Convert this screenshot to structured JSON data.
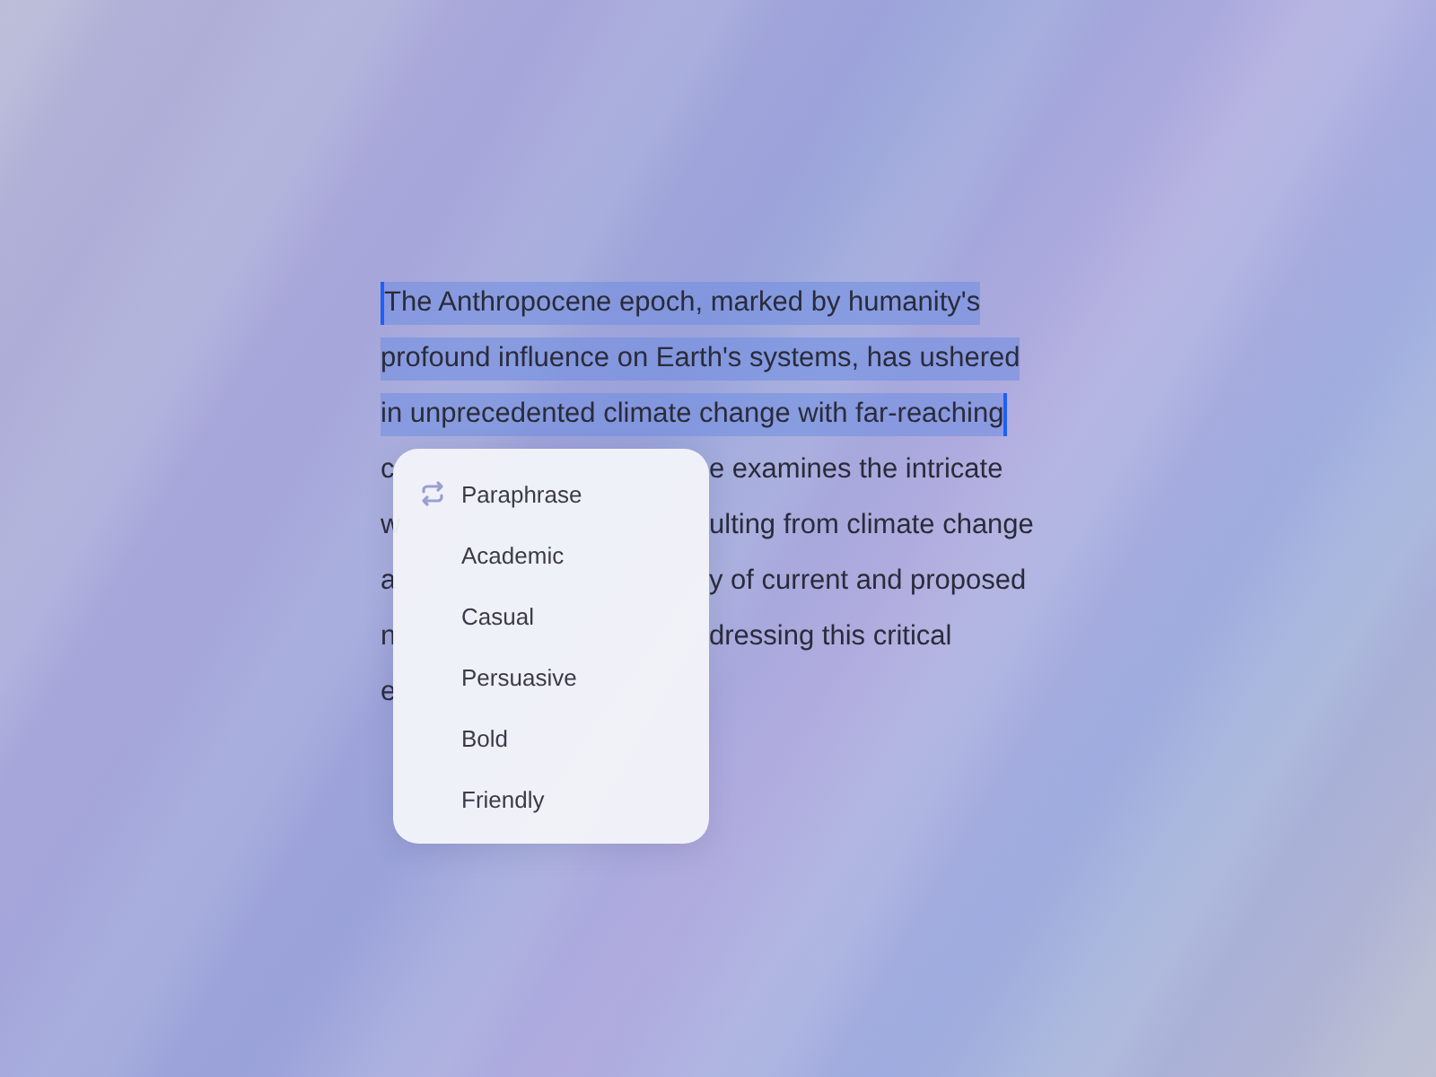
{
  "paragraph": {
    "lines": [
      {
        "start": "The Anthropocene epoch, marked by humanity's",
        "selected": true
      },
      {
        "start": "profound influence on Earth's systems, has ushered",
        "selected": true
      },
      {
        "start": "in unprecedented climate change with far-reaching",
        "selected": true
      },
      {
        "start": "c",
        "end": "e examines the intricate",
        "selected": false
      },
      {
        "start": "w",
        "end": "ulting from climate change",
        "selected": false
      },
      {
        "start": "a",
        "end": "y of current and proposed",
        "selected": false
      },
      {
        "start": "n",
        "end": "dressing this critical",
        "selected": false
      },
      {
        "start": "e",
        "selected": false
      }
    ]
  },
  "menu": {
    "header": "Paraphrase",
    "items": [
      "Academic",
      "Casual",
      "Persuasive",
      "Bold",
      "Friendly"
    ]
  }
}
